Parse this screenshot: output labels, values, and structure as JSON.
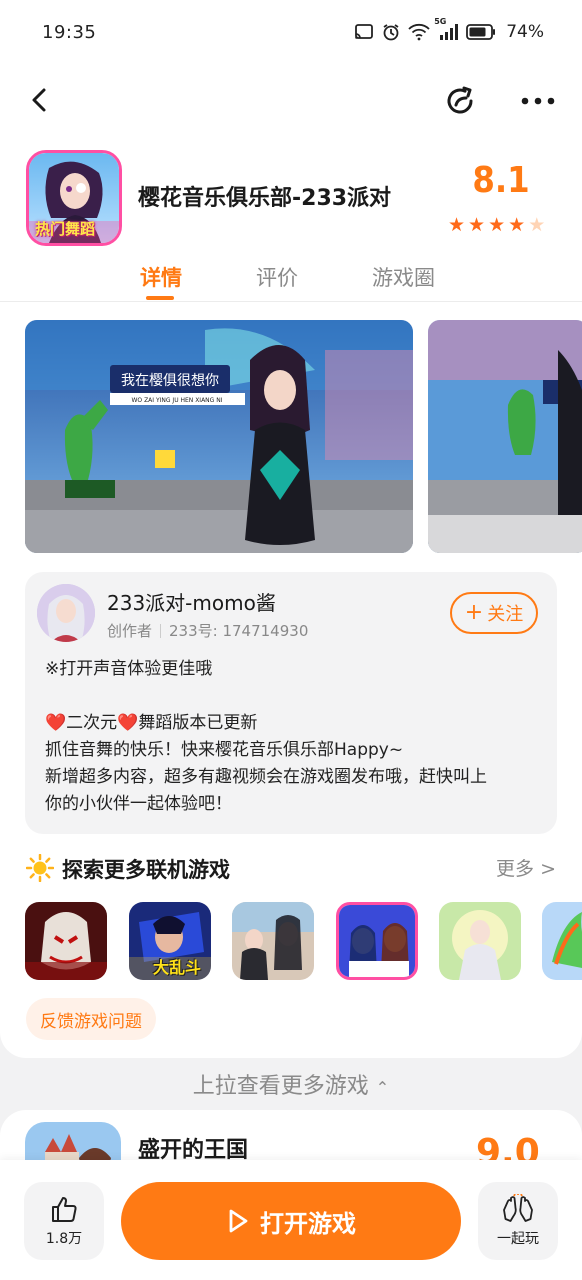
{
  "status_bar": {
    "time": "19:35",
    "network": "5G",
    "battery": "74%"
  },
  "nav": {
    "back_icon": "chevron-left-icon",
    "share_icon": "share-icon",
    "more_icon": "more-horizontal-icon"
  },
  "game": {
    "title": "樱花音乐俱乐部-233派对",
    "icon_badge": "热门舞蹈",
    "rating": "8.1",
    "stars": 4.5
  },
  "tabs": [
    {
      "label": "详情",
      "active": true
    },
    {
      "label": "评价",
      "active": false
    },
    {
      "label": "游戏圈",
      "active": false
    }
  ],
  "screenshots": {
    "sign_text": "我在樱俱很想你",
    "sign_subtext": "WO ZAI YING JU HEN XIANG NI"
  },
  "creator": {
    "name": "233派对-momo酱",
    "role": "创作者",
    "id_text": "233号: 174714930",
    "follow_label": "关注",
    "desc_lines": [
      "※打开声音体验更佳哦",
      "",
      "二次元",
      "舞蹈版本已更新",
      "抓住音舞的快乐！快来樱花音乐俱乐部Happy~",
      "新增超多内容，超多有趣视频会在游戏圈发布哦，赶快叫上",
      "你的小伙伴一起体验吧！"
    ]
  },
  "explore": {
    "title": "探索更多联机游戏",
    "more": "更多 >",
    "thumb_label": "大乱斗"
  },
  "feedback_label": "反馈游戏问题",
  "pull_hint": "上拉查看更多游戏",
  "next_game": {
    "title": "盛开的王国",
    "rating": "9.0"
  },
  "bottom": {
    "like_count": "1.8万",
    "open_label": "打开游戏",
    "play_together": "一起玩"
  },
  "colors": {
    "accent": "#ff7a14",
    "follow_border": "#ff7a14",
    "feedback_bg": "#fff1e8"
  }
}
